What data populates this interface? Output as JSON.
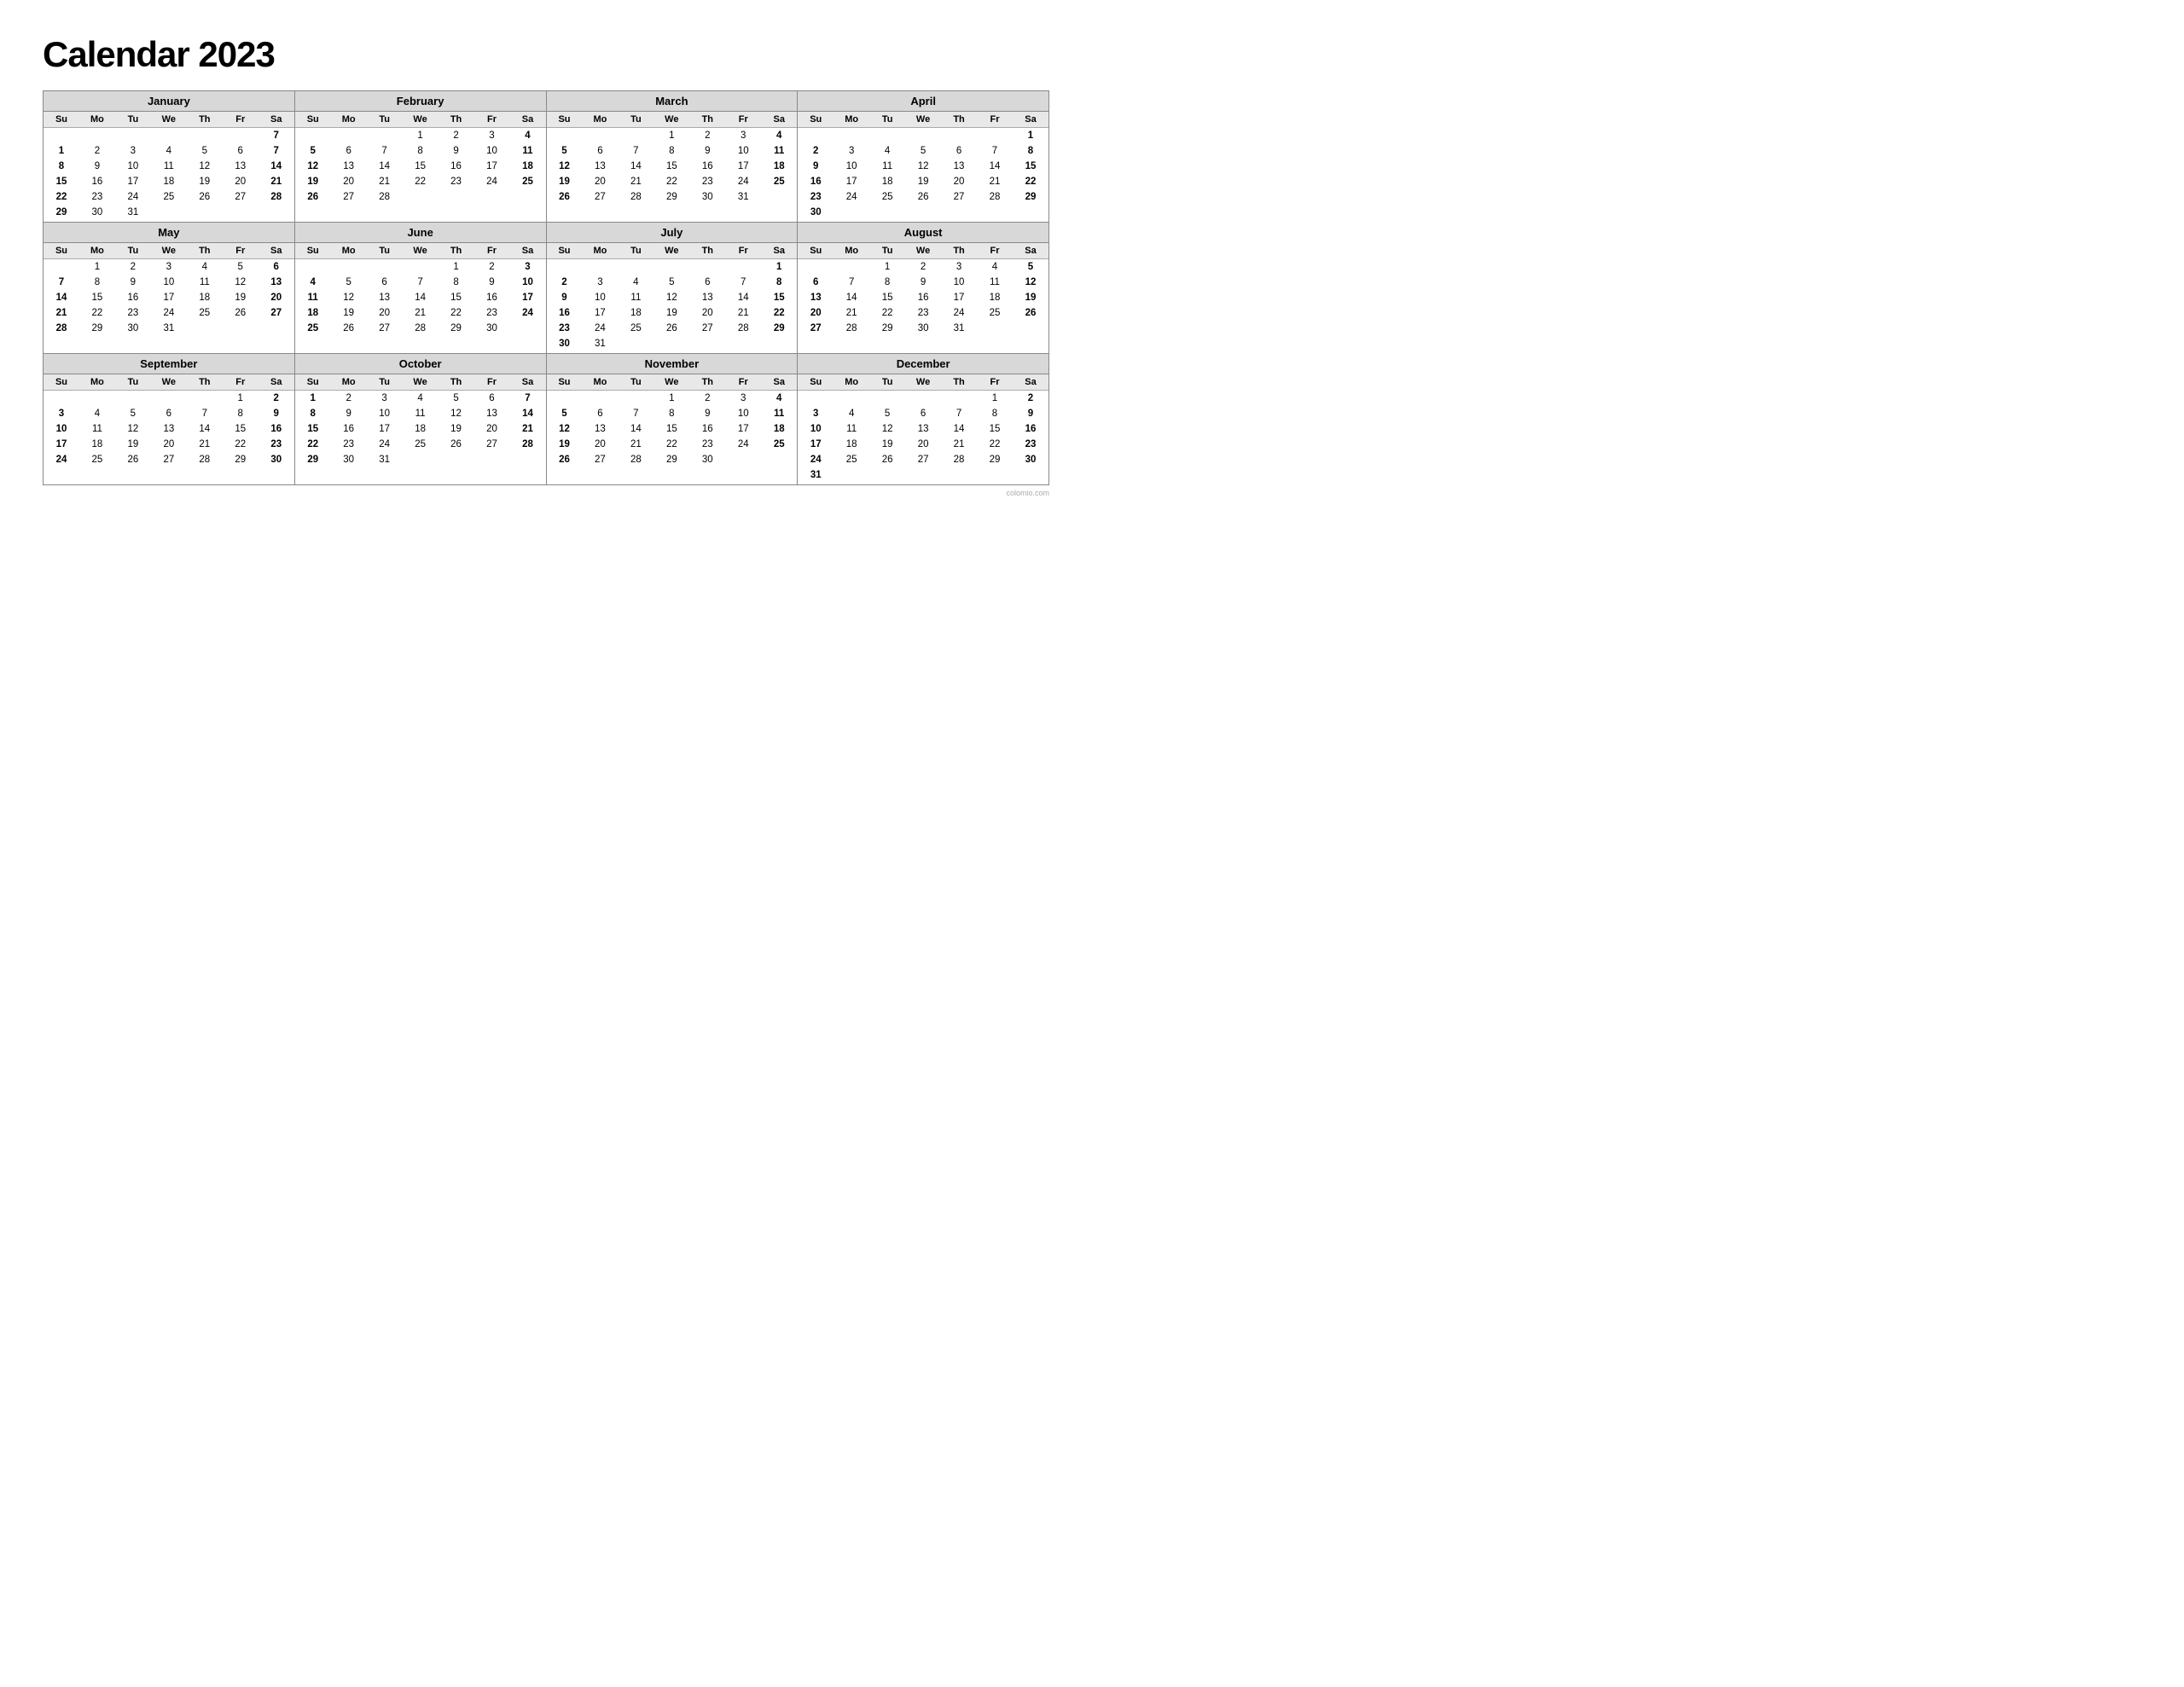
{
  "title": "Calendar 2023",
  "watermark": "colomio.com",
  "months": [
    {
      "name": "January",
      "weeks": [
        [
          "",
          "",
          "",
          "",
          "",
          "",
          "7"
        ],
        [
          "1",
          "2",
          "3",
          "4",
          "5",
          "6",
          "7"
        ],
        [
          "8",
          "9",
          "10",
          "11",
          "12",
          "13",
          "14"
        ],
        [
          "15",
          "16",
          "17",
          "18",
          "19",
          "20",
          "21"
        ],
        [
          "22",
          "23",
          "24",
          "25",
          "26",
          "27",
          "28"
        ],
        [
          "29",
          "30",
          "31",
          "",
          "",
          "",
          ""
        ]
      ],
      "startDay": 0
    },
    {
      "name": "February",
      "weeks": [
        [
          "",
          "",
          "",
          "1",
          "2",
          "3",
          "4"
        ],
        [
          "5",
          "6",
          "7",
          "8",
          "9",
          "10",
          "11"
        ],
        [
          "12",
          "13",
          "14",
          "15",
          "16",
          "17",
          "18"
        ],
        [
          "19",
          "20",
          "21",
          "22",
          "23",
          "24",
          "25"
        ],
        [
          "26",
          "27",
          "28",
          "",
          "",
          "",
          ""
        ],
        [
          "",
          "",
          "",
          "",
          "",
          "",
          ""
        ]
      ]
    },
    {
      "name": "March",
      "weeks": [
        [
          "",
          "",
          "",
          "1",
          "2",
          "3",
          "4"
        ],
        [
          "5",
          "6",
          "7",
          "8",
          "9",
          "10",
          "11"
        ],
        [
          "12",
          "13",
          "14",
          "15",
          "16",
          "17",
          "18"
        ],
        [
          "19",
          "20",
          "21",
          "22",
          "23",
          "24",
          "25"
        ],
        [
          "26",
          "27",
          "28",
          "29",
          "30",
          "31",
          ""
        ],
        [
          "",
          "",
          "",
          "",
          "",
          "",
          ""
        ]
      ]
    },
    {
      "name": "April",
      "weeks": [
        [
          "",
          "",
          "",
          "",
          "",
          "",
          "1"
        ],
        [
          "2",
          "3",
          "4",
          "5",
          "6",
          "7",
          "8"
        ],
        [
          "9",
          "10",
          "11",
          "12",
          "13",
          "14",
          "15"
        ],
        [
          "16",
          "17",
          "18",
          "19",
          "20",
          "21",
          "22"
        ],
        [
          "23",
          "24",
          "25",
          "26",
          "27",
          "28",
          "29"
        ],
        [
          "30",
          "",
          "",
          "",
          "",
          "",
          ""
        ]
      ]
    },
    {
      "name": "May",
      "weeks": [
        [
          "",
          "1",
          "2",
          "3",
          "4",
          "5",
          "6"
        ],
        [
          "7",
          "8",
          "9",
          "10",
          "11",
          "12",
          "13"
        ],
        [
          "14",
          "15",
          "16",
          "17",
          "18",
          "19",
          "20"
        ],
        [
          "21",
          "22",
          "23",
          "24",
          "25",
          "26",
          "27"
        ],
        [
          "28",
          "29",
          "30",
          "31",
          "",
          "",
          ""
        ],
        [
          "",
          "",
          "",
          "",
          "",
          "",
          ""
        ]
      ]
    },
    {
      "name": "June",
      "weeks": [
        [
          "",
          "",
          "",
          "",
          "1",
          "2",
          "3"
        ],
        [
          "4",
          "5",
          "6",
          "7",
          "8",
          "9",
          "10"
        ],
        [
          "11",
          "12",
          "13",
          "14",
          "15",
          "16",
          "17"
        ],
        [
          "18",
          "19",
          "20",
          "21",
          "22",
          "23",
          "24"
        ],
        [
          "25",
          "26",
          "27",
          "28",
          "29",
          "30",
          ""
        ],
        [
          "",
          "",
          "",
          "",
          "",
          "",
          ""
        ]
      ]
    },
    {
      "name": "July",
      "weeks": [
        [
          "",
          "",
          "",
          "",
          "",
          "",
          "1"
        ],
        [
          "2",
          "3",
          "4",
          "5",
          "6",
          "7",
          "8"
        ],
        [
          "9",
          "10",
          "11",
          "12",
          "13",
          "14",
          "15"
        ],
        [
          "16",
          "17",
          "18",
          "19",
          "20",
          "21",
          "22"
        ],
        [
          "23",
          "24",
          "25",
          "26",
          "27",
          "28",
          "29"
        ],
        [
          "30",
          "31",
          "",
          "",
          "",
          "",
          ""
        ]
      ]
    },
    {
      "name": "August",
      "weeks": [
        [
          "",
          "",
          "1",
          "2",
          "3",
          "4",
          "5"
        ],
        [
          "6",
          "7",
          "8",
          "9",
          "10",
          "11",
          "12"
        ],
        [
          "13",
          "14",
          "15",
          "16",
          "17",
          "18",
          "19"
        ],
        [
          "20",
          "21",
          "22",
          "23",
          "24",
          "25",
          "26"
        ],
        [
          "27",
          "28",
          "29",
          "30",
          "31",
          "",
          ""
        ],
        [
          "",
          "",
          "",
          "",
          "",
          "",
          ""
        ]
      ]
    },
    {
      "name": "September",
      "weeks": [
        [
          "",
          "",
          "",
          "",
          "",
          "1",
          "2"
        ],
        [
          "3",
          "4",
          "5",
          "6",
          "7",
          "8",
          "9"
        ],
        [
          "10",
          "11",
          "12",
          "13",
          "14",
          "15",
          "16"
        ],
        [
          "17",
          "18",
          "19",
          "20",
          "21",
          "22",
          "23"
        ],
        [
          "24",
          "25",
          "26",
          "27",
          "28",
          "29",
          "30"
        ],
        [
          "",
          "",
          "",
          "",
          "",
          "",
          ""
        ]
      ]
    },
    {
      "name": "October",
      "weeks": [
        [
          "1",
          "2",
          "3",
          "4",
          "5",
          "6",
          "7"
        ],
        [
          "8",
          "9",
          "10",
          "11",
          "12",
          "13",
          "14"
        ],
        [
          "15",
          "16",
          "17",
          "18",
          "19",
          "20",
          "21"
        ],
        [
          "22",
          "23",
          "24",
          "25",
          "26",
          "27",
          "28"
        ],
        [
          "29",
          "30",
          "31",
          "",
          "",
          "",
          ""
        ],
        [
          "",
          "",
          "",
          "",
          "",
          "",
          ""
        ]
      ]
    },
    {
      "name": "November",
      "weeks": [
        [
          "",
          "",
          "",
          "1",
          "2",
          "3",
          "4"
        ],
        [
          "5",
          "6",
          "7",
          "8",
          "9",
          "10",
          "11"
        ],
        [
          "12",
          "13",
          "14",
          "15",
          "16",
          "17",
          "18"
        ],
        [
          "19",
          "20",
          "21",
          "22",
          "23",
          "24",
          "25"
        ],
        [
          "26",
          "27",
          "28",
          "29",
          "30",
          "",
          ""
        ],
        [
          "",
          "",
          "",
          "",
          "",
          "",
          ""
        ]
      ]
    },
    {
      "name": "December",
      "weeks": [
        [
          "",
          "",
          "",
          "",
          "",
          "1",
          "2"
        ],
        [
          "3",
          "4",
          "5",
          "6",
          "7",
          "8",
          "9"
        ],
        [
          "10",
          "11",
          "12",
          "13",
          "14",
          "15",
          "16"
        ],
        [
          "17",
          "18",
          "19",
          "20",
          "21",
          "22",
          "23"
        ],
        [
          "24",
          "25",
          "26",
          "27",
          "28",
          "29",
          "30"
        ],
        [
          "31",
          "",
          "",
          "",
          "",
          "",
          ""
        ]
      ]
    }
  ],
  "dayHeaders": [
    "Su",
    "Mo",
    "Tu",
    "We",
    "Th",
    "Fr",
    "Sa"
  ],
  "boldDays": [
    "Su",
    "Sa"
  ]
}
